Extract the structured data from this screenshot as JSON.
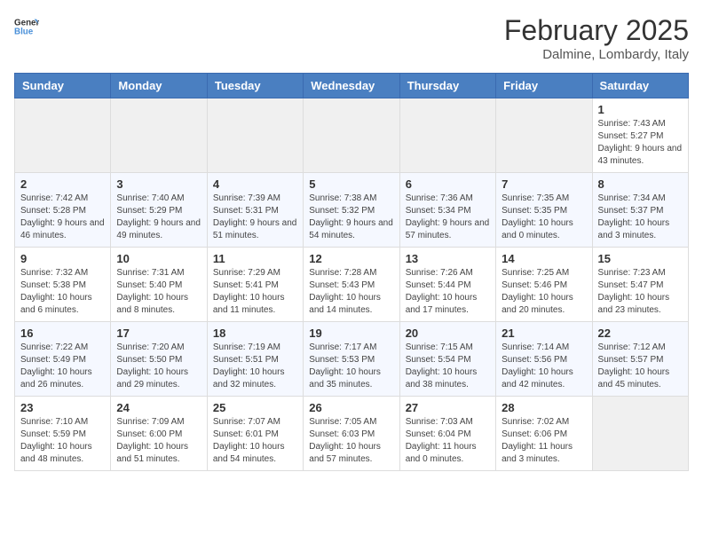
{
  "header": {
    "logo_general": "General",
    "logo_blue": "Blue",
    "month_year": "February 2025",
    "location": "Dalmine, Lombardy, Italy"
  },
  "days_of_week": [
    "Sunday",
    "Monday",
    "Tuesday",
    "Wednesday",
    "Thursday",
    "Friday",
    "Saturday"
  ],
  "weeks": [
    [
      {
        "day": "",
        "info": ""
      },
      {
        "day": "",
        "info": ""
      },
      {
        "day": "",
        "info": ""
      },
      {
        "day": "",
        "info": ""
      },
      {
        "day": "",
        "info": ""
      },
      {
        "day": "",
        "info": ""
      },
      {
        "day": "1",
        "info": "Sunrise: 7:43 AM\nSunset: 5:27 PM\nDaylight: 9 hours and 43 minutes."
      }
    ],
    [
      {
        "day": "2",
        "info": "Sunrise: 7:42 AM\nSunset: 5:28 PM\nDaylight: 9 hours and 46 minutes."
      },
      {
        "day": "3",
        "info": "Sunrise: 7:40 AM\nSunset: 5:29 PM\nDaylight: 9 hours and 49 minutes."
      },
      {
        "day": "4",
        "info": "Sunrise: 7:39 AM\nSunset: 5:31 PM\nDaylight: 9 hours and 51 minutes."
      },
      {
        "day": "5",
        "info": "Sunrise: 7:38 AM\nSunset: 5:32 PM\nDaylight: 9 hours and 54 minutes."
      },
      {
        "day": "6",
        "info": "Sunrise: 7:36 AM\nSunset: 5:34 PM\nDaylight: 9 hours and 57 minutes."
      },
      {
        "day": "7",
        "info": "Sunrise: 7:35 AM\nSunset: 5:35 PM\nDaylight: 10 hours and 0 minutes."
      },
      {
        "day": "8",
        "info": "Sunrise: 7:34 AM\nSunset: 5:37 PM\nDaylight: 10 hours and 3 minutes."
      }
    ],
    [
      {
        "day": "9",
        "info": "Sunrise: 7:32 AM\nSunset: 5:38 PM\nDaylight: 10 hours and 6 minutes."
      },
      {
        "day": "10",
        "info": "Sunrise: 7:31 AM\nSunset: 5:40 PM\nDaylight: 10 hours and 8 minutes."
      },
      {
        "day": "11",
        "info": "Sunrise: 7:29 AM\nSunset: 5:41 PM\nDaylight: 10 hours and 11 minutes."
      },
      {
        "day": "12",
        "info": "Sunrise: 7:28 AM\nSunset: 5:43 PM\nDaylight: 10 hours and 14 minutes."
      },
      {
        "day": "13",
        "info": "Sunrise: 7:26 AM\nSunset: 5:44 PM\nDaylight: 10 hours and 17 minutes."
      },
      {
        "day": "14",
        "info": "Sunrise: 7:25 AM\nSunset: 5:46 PM\nDaylight: 10 hours and 20 minutes."
      },
      {
        "day": "15",
        "info": "Sunrise: 7:23 AM\nSunset: 5:47 PM\nDaylight: 10 hours and 23 minutes."
      }
    ],
    [
      {
        "day": "16",
        "info": "Sunrise: 7:22 AM\nSunset: 5:49 PM\nDaylight: 10 hours and 26 minutes."
      },
      {
        "day": "17",
        "info": "Sunrise: 7:20 AM\nSunset: 5:50 PM\nDaylight: 10 hours and 29 minutes."
      },
      {
        "day": "18",
        "info": "Sunrise: 7:19 AM\nSunset: 5:51 PM\nDaylight: 10 hours and 32 minutes."
      },
      {
        "day": "19",
        "info": "Sunrise: 7:17 AM\nSunset: 5:53 PM\nDaylight: 10 hours and 35 minutes."
      },
      {
        "day": "20",
        "info": "Sunrise: 7:15 AM\nSunset: 5:54 PM\nDaylight: 10 hours and 38 minutes."
      },
      {
        "day": "21",
        "info": "Sunrise: 7:14 AM\nSunset: 5:56 PM\nDaylight: 10 hours and 42 minutes."
      },
      {
        "day": "22",
        "info": "Sunrise: 7:12 AM\nSunset: 5:57 PM\nDaylight: 10 hours and 45 minutes."
      }
    ],
    [
      {
        "day": "23",
        "info": "Sunrise: 7:10 AM\nSunset: 5:59 PM\nDaylight: 10 hours and 48 minutes."
      },
      {
        "day": "24",
        "info": "Sunrise: 7:09 AM\nSunset: 6:00 PM\nDaylight: 10 hours and 51 minutes."
      },
      {
        "day": "25",
        "info": "Sunrise: 7:07 AM\nSunset: 6:01 PM\nDaylight: 10 hours and 54 minutes."
      },
      {
        "day": "26",
        "info": "Sunrise: 7:05 AM\nSunset: 6:03 PM\nDaylight: 10 hours and 57 minutes."
      },
      {
        "day": "27",
        "info": "Sunrise: 7:03 AM\nSunset: 6:04 PM\nDaylight: 11 hours and 0 minutes."
      },
      {
        "day": "28",
        "info": "Sunrise: 7:02 AM\nSunset: 6:06 PM\nDaylight: 11 hours and 3 minutes."
      },
      {
        "day": "",
        "info": ""
      }
    ]
  ]
}
